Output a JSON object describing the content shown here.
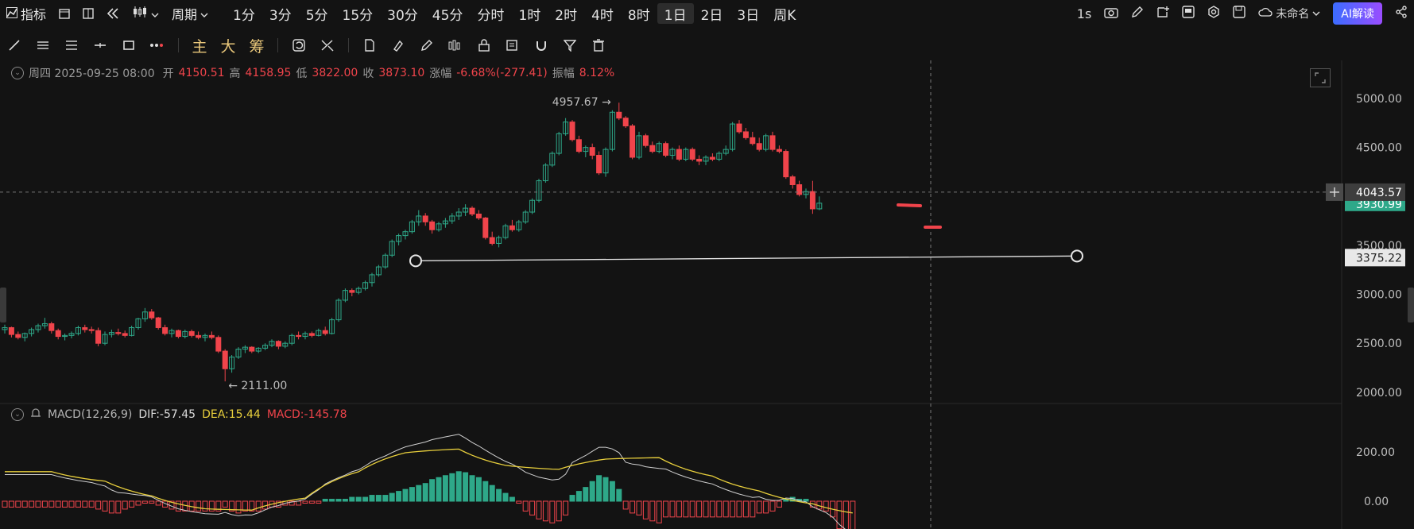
{
  "toolbar": {
    "indicator": "指标",
    "period": "周期",
    "periods": [
      "1分",
      "3分",
      "5分",
      "15分",
      "30分",
      "45分",
      "分时",
      "1时",
      "2时",
      "4时",
      "8时",
      "1日",
      "2日",
      "3日",
      "周K"
    ],
    "active_period": "1日",
    "right_interval": "1s",
    "layout_name": "未命名",
    "ai_label": "AI解读",
    "icons": [
      "camera-icon",
      "pen-icon",
      "add-window-icon",
      "template-icon",
      "settings-icon",
      "save-icon",
      "cloud-icon",
      "share-icon"
    ]
  },
  "drawbar": {
    "tools": [
      "line-icon",
      "parallel-icon",
      "channel-icon",
      "horizontal-line-icon",
      "rectangle-icon",
      "more-dots-icon"
    ],
    "text_tools": [
      "主",
      "大",
      "筹"
    ],
    "tools2": [
      "replay-icon",
      "measure-icon",
      "note-icon",
      "brush-icon",
      "bars-icon",
      "lock-icon",
      "edit-icon",
      "magnet-icon",
      "filter-icon",
      "trash-icon"
    ]
  },
  "info": {
    "date": "周四 2025-09-25 08:00",
    "open_label": "开",
    "open": "4150.51",
    "high_label": "高",
    "high": "4158.95",
    "low_label": "低",
    "low": "3822.00",
    "close_label": "收",
    "close": "3873.10",
    "change_label": "涨幅",
    "change": "-6.68%(-277.41)",
    "amp_label": "振幅",
    "amp": "8.12%"
  },
  "macd_info": {
    "name": "MACD(12,26,9)",
    "dif": "DIF:-57.45",
    "dea": "DEA:15.44",
    "macd": "MACD:-145.78"
  },
  "colors": {
    "up": "#2ea889",
    "down": "#f0444b",
    "dif": "#d0d0d0",
    "dea": "#e8cf3c",
    "bg": "#131313"
  },
  "chart_data": {
    "type": "candlestick",
    "y_ticks": [
      5000,
      4500,
      4000,
      3500,
      3000,
      2500,
      2000
    ],
    "macd_ticks": [
      "200.00",
      "0.00"
    ],
    "high_annotation": "4957.67",
    "low_annotation": "2111.00",
    "crosshair_price": "4043.57",
    "last_price": "3930.99",
    "hline_price": "3375.22",
    "candles": [
      [
        2640,
        2690,
        2600,
        2660
      ],
      [
        2660,
        2670,
        2560,
        2590
      ],
      [
        2590,
        2620,
        2540,
        2560
      ],
      [
        2560,
        2610,
        2520,
        2600
      ],
      [
        2600,
        2660,
        2570,
        2640
      ],
      [
        2640,
        2700,
        2610,
        2680
      ],
      [
        2680,
        2760,
        2650,
        2700
      ],
      [
        2700,
        2720,
        2600,
        2630
      ],
      [
        2630,
        2650,
        2540,
        2570
      ],
      [
        2570,
        2600,
        2530,
        2580
      ],
      [
        2580,
        2620,
        2550,
        2600
      ],
      [
        2600,
        2680,
        2580,
        2660
      ],
      [
        2660,
        2690,
        2610,
        2640
      ],
      [
        2640,
        2670,
        2600,
        2630
      ],
      [
        2630,
        2660,
        2470,
        2500
      ],
      [
        2500,
        2620,
        2480,
        2590
      ],
      [
        2590,
        2640,
        2560,
        2610
      ],
      [
        2610,
        2650,
        2580,
        2600
      ],
      [
        2600,
        2630,
        2560,
        2580
      ],
      [
        2580,
        2680,
        2570,
        2660
      ],
      [
        2660,
        2760,
        2640,
        2750
      ],
      [
        2750,
        2860,
        2720,
        2820
      ],
      [
        2820,
        2850,
        2740,
        2760
      ],
      [
        2760,
        2770,
        2640,
        2660
      ],
      [
        2660,
        2690,
        2580,
        2600
      ],
      [
        2600,
        2650,
        2560,
        2630
      ],
      [
        2630,
        2640,
        2550,
        2570
      ],
      [
        2570,
        2640,
        2550,
        2620
      ],
      [
        2620,
        2640,
        2560,
        2580
      ],
      [
        2580,
        2620,
        2540,
        2560
      ],
      [
        2560,
        2600,
        2520,
        2580
      ],
      [
        2580,
        2620,
        2540,
        2560
      ],
      [
        2560,
        2580,
        2400,
        2420
      ],
      [
        2420,
        2440,
        2111,
        2240
      ],
      [
        2240,
        2380,
        2200,
        2360
      ],
      [
        2360,
        2460,
        2340,
        2440
      ],
      [
        2440,
        2480,
        2400,
        2460
      ],
      [
        2460,
        2470,
        2400,
        2420
      ],
      [
        2420,
        2460,
        2400,
        2450
      ],
      [
        2450,
        2500,
        2430,
        2480
      ],
      [
        2480,
        2540,
        2460,
        2520
      ],
      [
        2520,
        2530,
        2440,
        2470
      ],
      [
        2470,
        2520,
        2450,
        2500
      ],
      [
        2500,
        2600,
        2480,
        2580
      ],
      [
        2580,
        2620,
        2540,
        2570
      ],
      [
        2570,
        2620,
        2540,
        2600
      ],
      [
        2600,
        2620,
        2560,
        2580
      ],
      [
        2580,
        2650,
        2570,
        2630
      ],
      [
        2630,
        2670,
        2580,
        2600
      ],
      [
        2600,
        2760,
        2590,
        2740
      ],
      [
        2740,
        2960,
        2720,
        2940
      ],
      [
        2940,
        3060,
        2920,
        3040
      ],
      [
        3040,
        3060,
        2980,
        3020
      ],
      [
        3020,
        3080,
        3000,
        3060
      ],
      [
        3060,
        3140,
        3040,
        3120
      ],
      [
        3120,
        3220,
        3080,
        3200
      ],
      [
        3200,
        3300,
        3180,
        3280
      ],
      [
        3280,
        3420,
        3260,
        3400
      ],
      [
        3400,
        3560,
        3380,
        3540
      ],
      [
        3540,
        3620,
        3500,
        3600
      ],
      [
        3600,
        3660,
        3560,
        3640
      ],
      [
        3640,
        3760,
        3620,
        3740
      ],
      [
        3740,
        3860,
        3700,
        3800
      ],
      [
        3800,
        3830,
        3700,
        3740
      ],
      [
        3740,
        3760,
        3620,
        3660
      ],
      [
        3660,
        3740,
        3640,
        3720
      ],
      [
        3720,
        3780,
        3680,
        3750
      ],
      [
        3750,
        3830,
        3720,
        3800
      ],
      [
        3800,
        3880,
        3760,
        3840
      ],
      [
        3840,
        3920,
        3800,
        3880
      ],
      [
        3880,
        3900,
        3800,
        3820
      ],
      [
        3820,
        3860,
        3760,
        3780
      ],
      [
        3780,
        3790,
        3560,
        3580
      ],
      [
        3580,
        3640,
        3500,
        3520
      ],
      [
        3520,
        3600,
        3480,
        3580
      ],
      [
        3580,
        3720,
        3560,
        3700
      ],
      [
        3700,
        3760,
        3640,
        3660
      ],
      [
        3660,
        3760,
        3640,
        3740
      ],
      [
        3740,
        3860,
        3720,
        3840
      ],
      [
        3840,
        3980,
        3820,
        3960
      ],
      [
        3960,
        4180,
        3940,
        4160
      ],
      [
        4160,
        4340,
        4140,
        4320
      ],
      [
        4320,
        4460,
        4300,
        4440
      ],
      [
        4440,
        4660,
        4420,
        4640
      ],
      [
        4640,
        4800,
        4620,
        4760
      ],
      [
        4760,
        4780,
        4560,
        4580
      ],
      [
        4580,
        4620,
        4440,
        4460
      ],
      [
        4460,
        4520,
        4400,
        4500
      ],
      [
        4500,
        4540,
        4380,
        4420
      ],
      [
        4420,
        4460,
        4220,
        4240
      ],
      [
        4240,
        4500,
        4200,
        4480
      ],
      [
        4480,
        4880,
        4460,
        4860
      ],
      [
        4860,
        4957.67,
        4780,
        4800
      ],
      [
        4800,
        4820,
        4700,
        4720
      ],
      [
        4720,
        4740,
        4380,
        4400
      ],
      [
        4400,
        4660,
        4380,
        4620
      ],
      [
        4620,
        4640,
        4500,
        4520
      ],
      [
        4520,
        4560,
        4440,
        4460
      ],
      [
        4460,
        4560,
        4440,
        4540
      ],
      [
        4540,
        4560,
        4400,
        4420
      ],
      [
        4420,
        4500,
        4380,
        4480
      ],
      [
        4480,
        4520,
        4360,
        4380
      ],
      [
        4380,
        4500,
        4360,
        4480
      ],
      [
        4480,
        4500,
        4360,
        4380
      ],
      [
        4380,
        4420,
        4320,
        4360
      ],
      [
        4360,
        4420,
        4320,
        4400
      ],
      [
        4400,
        4440,
        4360,
        4380
      ],
      [
        4380,
        4460,
        4360,
        4440
      ],
      [
        4440,
        4520,
        4420,
        4480
      ],
      [
        4480,
        4760,
        4460,
        4740
      ],
      [
        4740,
        4780,
        4640,
        4660
      ],
      [
        4660,
        4700,
        4580,
        4600
      ],
      [
        4600,
        4660,
        4520,
        4540
      ],
      [
        4540,
        4600,
        4460,
        4480
      ],
      [
        4480,
        4640,
        4460,
        4620
      ],
      [
        4620,
        4660,
        4460,
        4480
      ],
      [
        4480,
        4520,
        4440,
        4460
      ],
      [
        4460,
        4480,
        4180,
        4200
      ],
      [
        4200,
        4220,
        4080,
        4120
      ],
      [
        4120,
        4160,
        4000,
        4020
      ],
      [
        4020,
        4080,
        3980,
        4050
      ],
      [
        4050,
        4158.95,
        3822,
        3873
      ],
      [
        3873,
        4000,
        3860,
        3931
      ]
    ],
    "macd_hist": [
      -24,
      -24,
      -24,
      -24,
      -24,
      -24,
      -24,
      -24,
      -24,
      -24,
      -24,
      -24,
      -24,
      -24,
      -32,
      -40,
      -48,
      -48,
      -32,
      -24,
      -16,
      -8,
      -8,
      -16,
      -24,
      -32,
      -40,
      -40,
      -40,
      -40,
      -40,
      -40,
      -40,
      -24,
      -40,
      -48,
      -40,
      -40,
      -40,
      -32,
      -24,
      -24,
      -16,
      -16,
      -16,
      -8,
      -8,
      -8,
      8,
      8,
      8,
      8,
      16,
      16,
      16,
      24,
      24,
      24,
      32,
      40,
      48,
      56,
      64,
      72,
      88,
      96,
      104,
      112,
      120,
      116,
      104,
      96,
      80,
      64,
      48,
      32,
      16,
      -8,
      -40,
      -56,
      -72,
      -80,
      -88,
      -80,
      -56,
      24,
      40,
      56,
      80,
      104,
      96,
      80,
      48,
      -32,
      -48,
      -56,
      -72,
      -80,
      -88,
      -64,
      -64,
      -64,
      -64,
      -64,
      -64,
      -64,
      -64,
      -64,
      -64,
      -64,
      -64,
      -64,
      -64,
      -48,
      -48,
      -40,
      -24,
      8,
      16,
      8,
      8,
      -24,
      -32,
      -40,
      -64,
      -112,
      -145.78,
      -150
    ]
  }
}
